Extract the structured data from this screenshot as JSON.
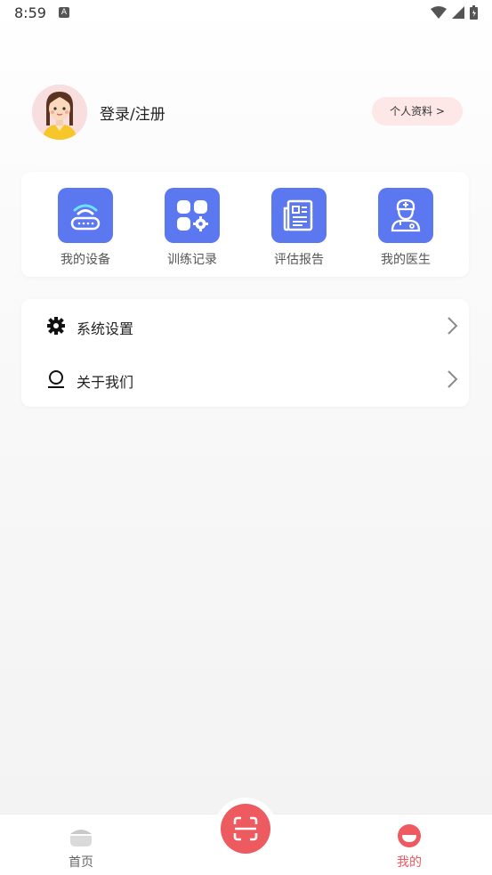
{
  "status_bar": {
    "time": "8:59",
    "notification_icon": "A"
  },
  "profile": {
    "login_label": "登录/注册",
    "profile_button": "个人资料 >"
  },
  "grid": [
    {
      "label": "我的设备",
      "icon": "router-icon"
    },
    {
      "label": "训练记录",
      "icon": "apps-gear-icon"
    },
    {
      "label": "评估报告",
      "icon": "newspaper-icon"
    },
    {
      "label": "我的医生",
      "icon": "doctor-icon"
    }
  ],
  "menu": [
    {
      "label": "系统设置",
      "icon": "gear-icon"
    },
    {
      "label": "关于我们",
      "icon": "person-icon"
    }
  ],
  "tabbar": {
    "home_label": "首页",
    "mine_label": "我的"
  },
  "colors": {
    "accent": "#5b78f0",
    "brand_red": "#ed5a5f",
    "tab_inactive": "#666666"
  }
}
